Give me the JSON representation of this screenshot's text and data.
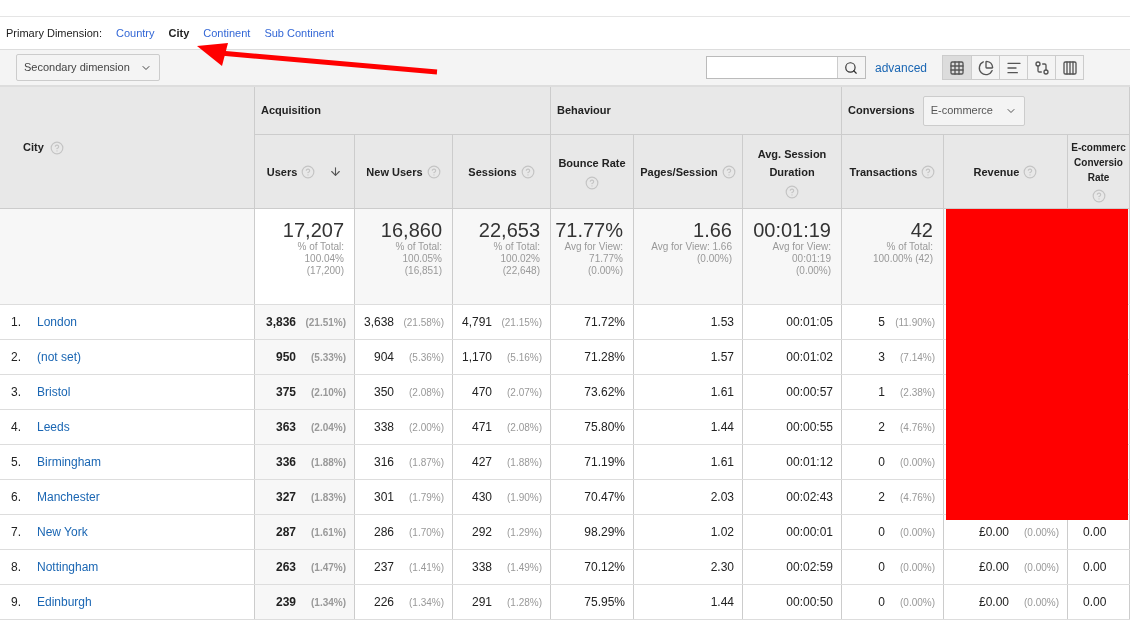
{
  "primary_dimension": {
    "label": "Primary Dimension:",
    "options": [
      {
        "label": "Country",
        "selected": false
      },
      {
        "label": "City",
        "selected": true
      },
      {
        "label": "Continent",
        "selected": false
      },
      {
        "label": "Sub Continent",
        "selected": false
      }
    ]
  },
  "toolbar": {
    "secondary_dimension": "Secondary dimension",
    "advanced": "advanced",
    "views": [
      {
        "kind": "table",
        "selected": true
      },
      {
        "kind": "pie",
        "selected": false
      },
      {
        "kind": "bars",
        "selected": false
      },
      {
        "kind": "compare",
        "selected": false
      },
      {
        "kind": "pivot",
        "selected": false
      }
    ]
  },
  "table": {
    "dimension_column": "City",
    "groups": [
      {
        "label": "Acquisition"
      },
      {
        "label": "Behaviour"
      },
      {
        "label": "Conversions",
        "dropdown": "E-commerce"
      }
    ],
    "columns": [
      {
        "label": "Users",
        "sorted": true
      },
      {
        "label": "New Users",
        "sorted": false
      },
      {
        "label": "Sessions",
        "sorted": false
      },
      {
        "label": "Bounce Rate",
        "sorted": false
      },
      {
        "label": "Pages/Session",
        "sorted": false
      },
      {
        "label": "Avg. Session Duration",
        "sorted": false
      },
      {
        "label": "Transactions",
        "sorted": false
      },
      {
        "label": "Revenue",
        "sorted": false
      },
      {
        "label": "E-commerc Conversio Rate",
        "sorted": false
      }
    ],
    "totals": [
      {
        "value": "17,207",
        "lines": [
          "% of Total:",
          "100.04%",
          "(17,200)"
        ]
      },
      {
        "value": "16,860",
        "lines": [
          "% of Total:",
          "100.05%",
          "(16,851)"
        ]
      },
      {
        "value": "22,653",
        "lines": [
          "% of Total:",
          "100.02%",
          "(22,648)"
        ]
      },
      {
        "value": "71.77%",
        "lines": [
          "Avg for View:",
          "71.77%",
          "(0.00%)"
        ]
      },
      {
        "value": "1.66",
        "lines": [
          "Avg for View: 1.66",
          "(0.00%)"
        ]
      },
      {
        "value": "00:01:19",
        "lines": [
          "Avg for View:",
          "00:01:19",
          "(0.00%)"
        ]
      },
      {
        "value": "42",
        "lines": [
          "% of Total:",
          "100.00% (42)"
        ]
      }
    ],
    "rows": [
      {
        "index": "1.",
        "city": "London",
        "cells": [
          {
            "value": "3,836",
            "pct": "(21.51%)"
          },
          {
            "value": "3,638",
            "pct": "(21.58%)"
          },
          {
            "value": "4,791",
            "pct": "(21.15%)"
          },
          {
            "value": "71.72%"
          },
          {
            "value": "1.53"
          },
          {
            "value": "00:01:05"
          },
          {
            "value": "5",
            "pct": "(11.90%)"
          }
        ]
      },
      {
        "index": "2.",
        "city": "(not set)",
        "cells": [
          {
            "value": "950",
            "pct": "(5.33%)"
          },
          {
            "value": "904",
            "pct": "(5.36%)"
          },
          {
            "value": "1,170",
            "pct": "(5.16%)"
          },
          {
            "value": "71.28%"
          },
          {
            "value": "1.57"
          },
          {
            "value": "00:01:02"
          },
          {
            "value": "3",
            "pct": "(7.14%)"
          }
        ]
      },
      {
        "index": "3.",
        "city": "Bristol",
        "cells": [
          {
            "value": "375",
            "pct": "(2.10%)"
          },
          {
            "value": "350",
            "pct": "(2.08%)"
          },
          {
            "value": "470",
            "pct": "(2.07%)"
          },
          {
            "value": "73.62%"
          },
          {
            "value": "1.61"
          },
          {
            "value": "00:00:57"
          },
          {
            "value": "1",
            "pct": "(2.38%)"
          }
        ]
      },
      {
        "index": "4.",
        "city": "Leeds",
        "cells": [
          {
            "value": "363",
            "pct": "(2.04%)"
          },
          {
            "value": "338",
            "pct": "(2.00%)"
          },
          {
            "value": "471",
            "pct": "(2.08%)"
          },
          {
            "value": "75.80%"
          },
          {
            "value": "1.44"
          },
          {
            "value": "00:00:55"
          },
          {
            "value": "2",
            "pct": "(4.76%)"
          }
        ]
      },
      {
        "index": "5.",
        "city": "Birmingham",
        "cells": [
          {
            "value": "336",
            "pct": "(1.88%)"
          },
          {
            "value": "316",
            "pct": "(1.87%)"
          },
          {
            "value": "427",
            "pct": "(1.88%)"
          },
          {
            "value": "71.19%"
          },
          {
            "value": "1.61"
          },
          {
            "value": "00:01:12"
          },
          {
            "value": "0",
            "pct": "(0.00%)"
          }
        ]
      },
      {
        "index": "6.",
        "city": "Manchester",
        "cells": [
          {
            "value": "327",
            "pct": "(1.83%)"
          },
          {
            "value": "301",
            "pct": "(1.79%)"
          },
          {
            "value": "430",
            "pct": "(1.90%)"
          },
          {
            "value": "70.47%"
          },
          {
            "value": "2.03"
          },
          {
            "value": "00:02:43"
          },
          {
            "value": "2",
            "pct": "(4.76%)"
          }
        ]
      },
      {
        "index": "7.",
        "city": "New York",
        "cells": [
          {
            "value": "287",
            "pct": "(1.61%)"
          },
          {
            "value": "286",
            "pct": "(1.70%)"
          },
          {
            "value": "292",
            "pct": "(1.29%)"
          },
          {
            "value": "98.29%"
          },
          {
            "value": "1.02"
          },
          {
            "value": "00:00:01"
          },
          {
            "value": "0",
            "pct": "(0.00%)"
          },
          {
            "value": "£0.00",
            "pct": "(0.00%)"
          },
          {
            "value": "0.00"
          }
        ]
      },
      {
        "index": "8.",
        "city": "Nottingham",
        "cells": [
          {
            "value": "263",
            "pct": "(1.47%)"
          },
          {
            "value": "237",
            "pct": "(1.41%)"
          },
          {
            "value": "338",
            "pct": "(1.49%)"
          },
          {
            "value": "70.12%"
          },
          {
            "value": "2.30"
          },
          {
            "value": "00:02:59"
          },
          {
            "value": "0",
            "pct": "(0.00%)"
          },
          {
            "value": "£0.00",
            "pct": "(0.00%)"
          },
          {
            "value": "0.00"
          }
        ]
      },
      {
        "index": "9.",
        "city": "Edinburgh",
        "cells": [
          {
            "value": "239",
            "pct": "(1.34%)"
          },
          {
            "value": "226",
            "pct": "(1.34%)"
          },
          {
            "value": "291",
            "pct": "(1.28%)"
          },
          {
            "value": "75.95%"
          },
          {
            "value": "1.44"
          },
          {
            "value": "00:00:50"
          },
          {
            "value": "0",
            "pct": "(0.00%)"
          },
          {
            "value": "£0.00",
            "pct": "(0.00%)"
          },
          {
            "value": "0.00"
          }
        ]
      }
    ]
  }
}
